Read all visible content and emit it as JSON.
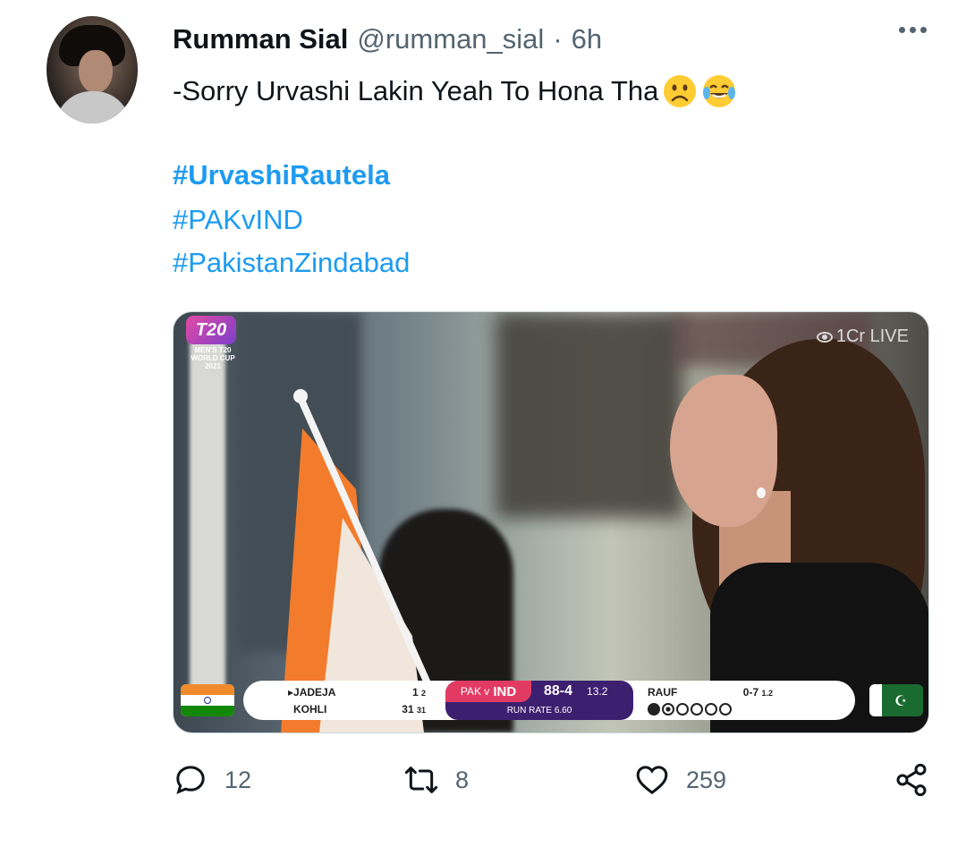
{
  "tweet": {
    "author_name": "Rumman Sial",
    "handle": "@rumman_sial",
    "separator": "·",
    "time": "6h",
    "text": "-Sorry Urvashi Lakin Yeah To Hona Tha",
    "emojis": [
      "frowning-face",
      "face-with-tears-of-joy"
    ],
    "hashtags": [
      "#UrvashiRautela",
      "#PAKvIND",
      "#PakistanZindabad"
    ]
  },
  "media": {
    "logo_text": "T20",
    "logo_subtitle": "MEN'S T20 WORLD CUP 2021",
    "live_badge": "1Cr LIVE",
    "scoreboard": {
      "batters": [
        {
          "name": "JADEJA",
          "runs": "1",
          "balls": "2"
        },
        {
          "name": "KOHLI",
          "runs": "31",
          "balls": "31"
        }
      ],
      "match": "PAK v",
      "batting_team": "IND",
      "score": "88-4",
      "overs": "13.2",
      "run_rate": "RUN RATE 6.60",
      "bowler": "RAUF",
      "bowler_figures": "0-7",
      "bowler_overs": "1.2"
    }
  },
  "actions": {
    "replies": "12",
    "retweets": "8",
    "likes": "259"
  },
  "colors": {
    "link": "#1d9bf0",
    "secondary_text": "#536471",
    "primary_text": "#0f1419"
  }
}
